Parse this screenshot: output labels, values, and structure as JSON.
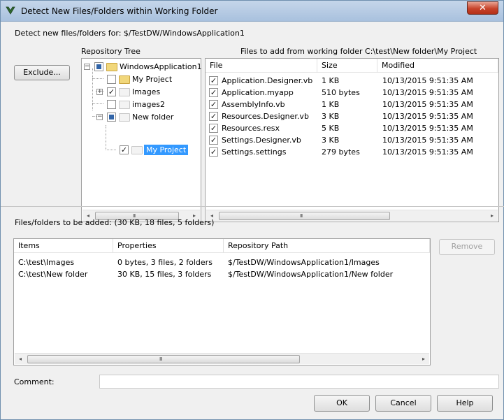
{
  "window": {
    "title": "Detect New Files/Folders within Working Folder"
  },
  "detect_for": {
    "label": "Detect new files/folders for: $/TestDW/WindowsApplication1"
  },
  "buttons": {
    "exclude": "Exclude...",
    "remove": "Remove",
    "ok": "OK",
    "cancel": "Cancel",
    "help": "Help"
  },
  "repository_tree": {
    "title": "Repository Tree",
    "nodes": [
      {
        "label": "WindowsApplication1",
        "checked": "partial",
        "expanded": true
      },
      {
        "label": "My Project",
        "checked": false
      },
      {
        "label": "Images",
        "checked": true,
        "collapsed": true
      },
      {
        "label": "images2",
        "checked": false
      },
      {
        "label": "New folder",
        "checked": "partial",
        "expanded": true
      },
      {
        "label": "My Project",
        "checked": true,
        "selected": true
      }
    ]
  },
  "files_to_add": {
    "title": "Files to add from working folder C:\\test\\New folder\\My Project",
    "columns": [
      "File",
      "Size",
      "Modified"
    ],
    "rows": [
      {
        "name": "Application.Designer.vb",
        "size": "1 KB",
        "modified": "10/13/2015 9:51:35 AM"
      },
      {
        "name": "Application.myapp",
        "size": "510 bytes",
        "modified": "10/13/2015 9:51:35 AM"
      },
      {
        "name": "AssemblyInfo.vb",
        "size": "1 KB",
        "modified": "10/13/2015 9:51:35 AM"
      },
      {
        "name": "Resources.Designer.vb",
        "size": "3 KB",
        "modified": "10/13/2015 9:51:35 AM"
      },
      {
        "name": "Resources.resx",
        "size": "5 KB",
        "modified": "10/13/2015 9:51:35 AM"
      },
      {
        "name": "Settings.Designer.vb",
        "size": "3 KB",
        "modified": "10/13/2015 9:51:35 AM"
      },
      {
        "name": "Settings.settings",
        "size": "279 bytes",
        "modified": "10/13/2015 9:51:35 AM"
      }
    ]
  },
  "to_be_added": {
    "summary": "Files/folders to be added: (30 KB, 18 files, 5 folders)",
    "columns": [
      "Items",
      "Properties",
      "Repository Path"
    ],
    "rows": [
      {
        "item": "C:\\test\\Images",
        "properties": "0 bytes, 3 files, 2 folders",
        "path": "$/TestDW/WindowsApplication1/Images"
      },
      {
        "item": "C:\\test\\New folder",
        "properties": "30 KB, 15 files, 3 folders",
        "path": "$/TestDW/WindowsApplication1/New folder"
      }
    ]
  },
  "comment": {
    "label": "Comment:",
    "value": ""
  },
  "scroll": {
    "grip": "III"
  },
  "icons": {
    "close": "✕",
    "check": "✓",
    "expand_minus": "−",
    "expand_plus": "+",
    "arrow_left": "◂",
    "arrow_right": "▸"
  }
}
